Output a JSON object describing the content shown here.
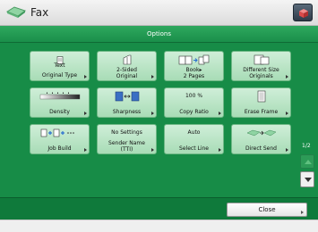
{
  "header": {
    "title": "Fax"
  },
  "options_bar": {
    "label": "Options"
  },
  "tiles": [
    {
      "id": "text-original-type",
      "label_top": "Text",
      "label": "Original Type",
      "has_arrow": true
    },
    {
      "id": "two-sided-original",
      "label": "2-Sided\nOriginal",
      "has_arrow": true
    },
    {
      "id": "book-2-pages",
      "label": "Book▸\n2 Pages",
      "has_arrow": false
    },
    {
      "id": "different-size-originals",
      "label": "Different Size\nOriginals",
      "has_arrow": true
    },
    {
      "id": "density",
      "label": "Density",
      "has_arrow": true
    },
    {
      "id": "sharpness",
      "label": "Sharpness",
      "has_arrow": true
    },
    {
      "id": "copy-ratio",
      "label_top": "100 %",
      "label": "Copy Ratio",
      "has_arrow": true
    },
    {
      "id": "erase-frame",
      "label": "Erase Frame",
      "has_arrow": true
    },
    {
      "id": "job-build",
      "label": "Job Build",
      "has_arrow": true
    },
    {
      "id": "sender-name",
      "label_top": "No Settings",
      "label": "Sender Name\n(TTI)",
      "has_arrow": true
    },
    {
      "id": "select-line",
      "label_top": "Auto",
      "label": "Select Line",
      "has_arrow": true
    },
    {
      "id": "direct-send",
      "label": "Direct Send",
      "has_arrow": true
    }
  ],
  "pager": {
    "text": "1/2"
  },
  "footer": {
    "close_label": "Close"
  },
  "colors": {
    "panel": "#178c47",
    "tile": "#b8e4c4",
    "options_bar": "#2ea85e"
  }
}
